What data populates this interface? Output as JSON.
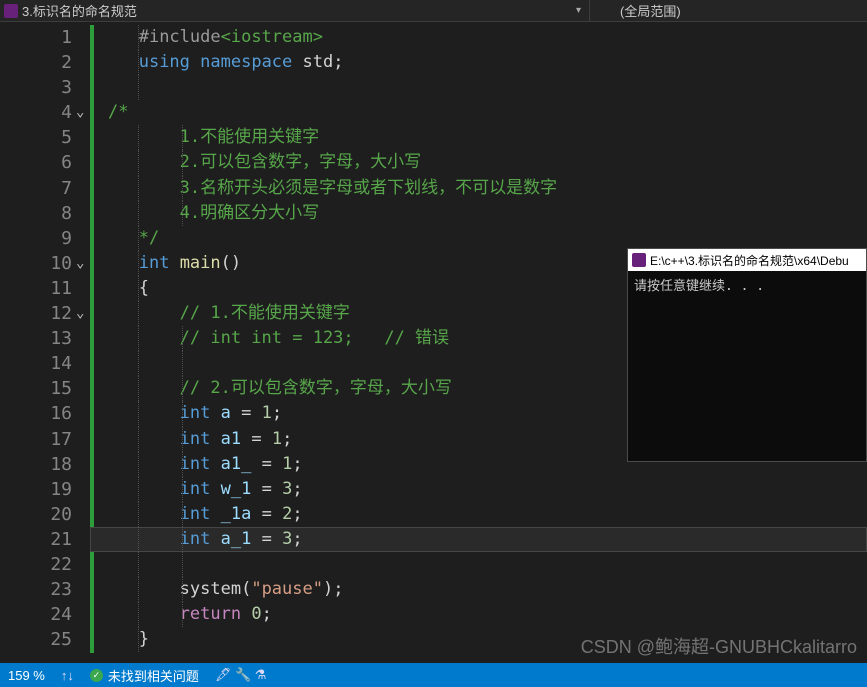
{
  "tab": {
    "title": "3.标识名的命名规范",
    "scope": "(全局范围)"
  },
  "lines": [
    "1",
    "2",
    "3",
    "4",
    "5",
    "6",
    "7",
    "8",
    "9",
    "10",
    "11",
    "12",
    "13",
    "14",
    "15",
    "16",
    "17",
    "18",
    "19",
    "20",
    "21",
    "22",
    "23",
    "24",
    "25"
  ],
  "code": {
    "l1_prep": "#include",
    "l1_lib": "<iostream>",
    "l2_using": "using",
    "l2_ns": "namespace",
    "l2_std": "std",
    "semi": ";",
    "c_open": "/*",
    "c1": "1.不能使用关键字",
    "c2": "2.可以包含数字，字母，大小写",
    "c3": "3.名称开头必须是字母或者下划线，不可以是数字",
    "c4": "4.明确区分大小写",
    "c_close": "*/",
    "int": "int",
    "main": "main",
    "parens": "()",
    "lbrace": "{",
    "rbrace": "}",
    "cm1": "// 1.不能使用关键字",
    "cm2": "// int int = 123;   // 错误",
    "cm3": "// 2.可以包含数字，字母，大小写",
    "eq": " = ",
    "v_a": "a",
    "n1": "1",
    "v_a1": "a1",
    "v_a1u": "a1_",
    "v_w1": "w_1",
    "n3": "3",
    "v_u1a": "_1a",
    "n2": "2",
    "v_au1": "a_1",
    "system": "system",
    "pause": "\"pause\"",
    "return": "return",
    "zero": "0"
  },
  "console": {
    "title": "E:\\c++\\3.标识名的命名规范\\x64\\Debu",
    "body": "请按任意键继续. . ."
  },
  "status": {
    "zoom": "159 %",
    "arrows": "↑↓",
    "issues": "未找到相关问题",
    "tools": "🖋 🔧 ⚗"
  },
  "watermark": "CSDN @鲍海超-GNUBHCkalitarro"
}
